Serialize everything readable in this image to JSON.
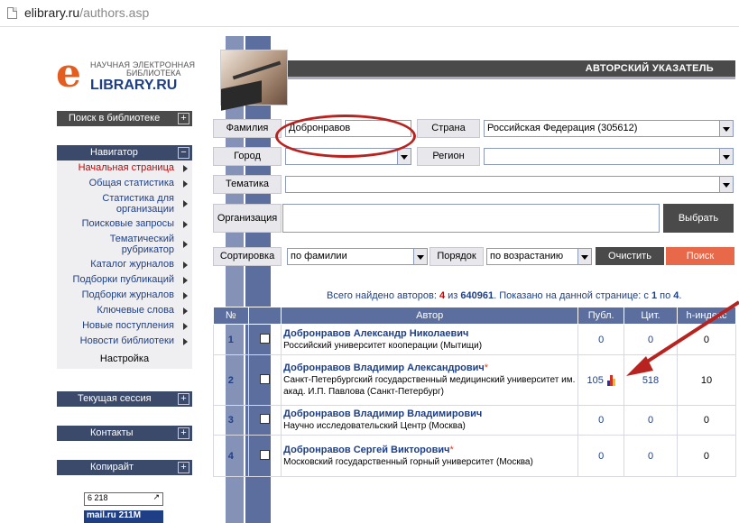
{
  "browser": {
    "url_host": "elibrary.ru",
    "url_path": "/authors.asp"
  },
  "logo": {
    "line1": "НАУЧНАЯ ЭЛЕКТРОННАЯ",
    "line2": "БИБЛИОТЕКА",
    "brand_e": "e",
    "brand": "LIBRARY.RU"
  },
  "sidebar": {
    "search": "Поиск в библиотеке",
    "navigator": "Навигатор",
    "items": [
      "Начальная страница",
      "Общая статистика",
      "Статистика для организации",
      "Поисковые запросы",
      "Тематический рубрикатор",
      "Каталог журналов",
      "Подборки публикаций",
      "Подборки журналов",
      "Ключевые слова",
      "Новые поступления",
      "Новости библиотеки"
    ],
    "settings": "Настройка",
    "session": "Текущая сессия",
    "contacts": "Контакты",
    "copyright": "Копирайт",
    "counter1": "6 218",
    "counter2": "mail.ru 211M"
  },
  "header": {
    "title": "АВТОРСКИЙ УКАЗАТЕЛЬ"
  },
  "form": {
    "surname_label": "Фамилия",
    "surname_value": "Добронравов",
    "country_label": "Страна",
    "country_value": "Российская Федерация  (305612)",
    "city_label": "Город",
    "region_label": "Регион",
    "topic_label": "Тематика",
    "org_label": "Организация",
    "choose": "Выбрать",
    "sort_label": "Сортировка",
    "sort_value": "по фамилии",
    "order_label": "Порядок",
    "order_value": "по возрастанию",
    "clear": "Очистить",
    "search": "Поиск"
  },
  "summary": {
    "prefix": "Всего найдено авторов: ",
    "found": "4",
    "mid": " из ",
    "total": "640961",
    "suffix": ".   Показано на данной странице: с ",
    "from": "1",
    "to_word": " по ",
    "to": "4",
    "end": "."
  },
  "table": {
    "headers": [
      "№",
      "",
      "Автор",
      "Публ.",
      "Цит.",
      "h-индекс"
    ],
    "rows": [
      {
        "num": "1",
        "name": "Добронравов Александр Николаевич",
        "star": "",
        "affil": "Российский университет кооперации (Мытищи)",
        "publ": "0",
        "cit": "0",
        "h": "0"
      },
      {
        "num": "2",
        "name": "Добронравов Владимир Александрович",
        "star": "*",
        "affil": "Санкт-Петербургский государственный медицинский университет им. акад. И.П. Павлова (Санкт-Петербург)",
        "publ": "105",
        "cit": "518",
        "h": "10"
      },
      {
        "num": "3",
        "name": "Добронравов Владимир Владимирович",
        "star": "",
        "affil": "Научно исследовательский Центр (Москва)",
        "publ": "0",
        "cit": "0",
        "h": "0"
      },
      {
        "num": "4",
        "name": "Добронравов Сергей Викторович",
        "star": "*",
        "affil": "Московский государственный горный университет (Москва)",
        "publ": "0",
        "cit": "0",
        "h": "0"
      }
    ]
  },
  "colors": {
    "accent_red": "#b8231f",
    "nav_blue": "#1e3f86",
    "stripe": "#5b6e9e",
    "search_btn": "#e8684a"
  }
}
